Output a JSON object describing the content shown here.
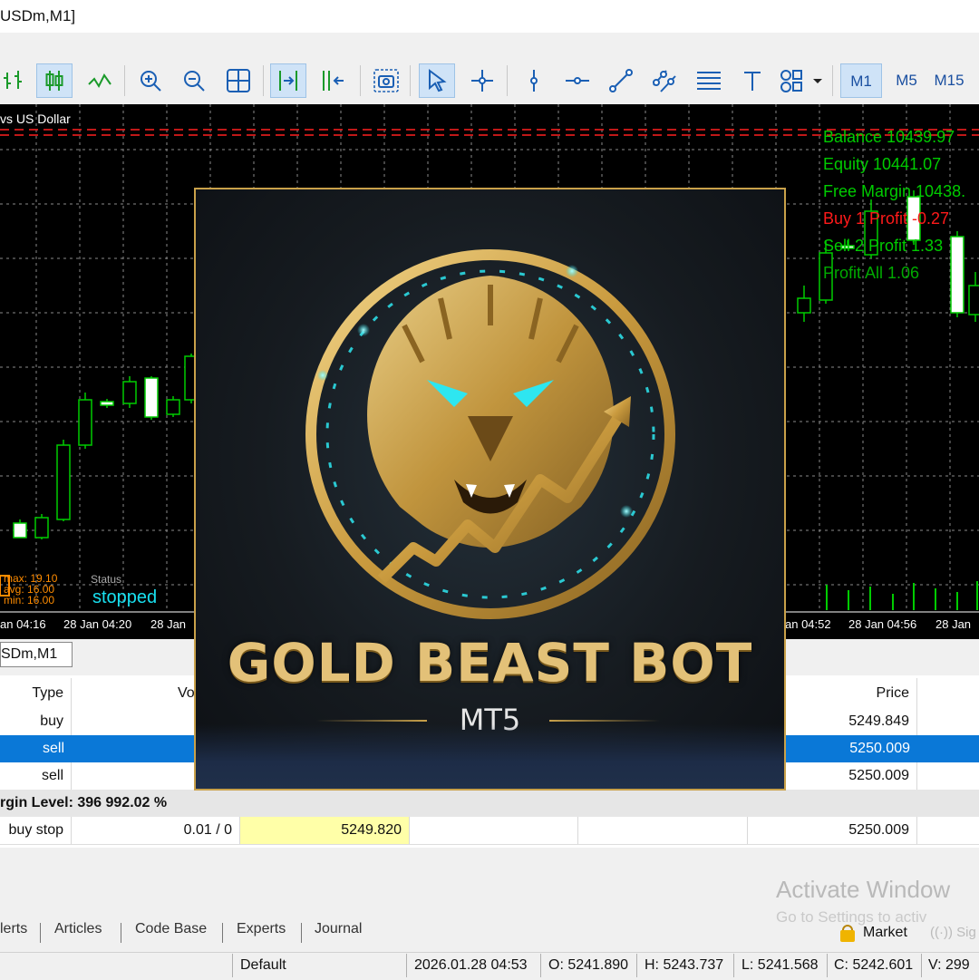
{
  "window": {
    "title": "USDm,M1]"
  },
  "toolbar": {
    "timeframes": [
      "M1",
      "M5",
      "M15"
    ],
    "active_timeframe": "M1"
  },
  "chart": {
    "symbol_label": "vs US Dollar",
    "account": {
      "balance": "Balance 10439.97",
      "equity": "Equity 10441.07",
      "free_margin": "Free Margin 10438.",
      "buy": "Buy 1  Profit -0.27",
      "sell": "Sell 2  Profit 1.33",
      "profit_all": "Profit All 1.06"
    },
    "indicator": {
      "max": "max: 19.10",
      "avg": "avg: 16.00",
      "min": "min: 16.00",
      "status_label": "Status",
      "status_value": "stopped"
    },
    "time_labels": [
      "an 04:16",
      "28 Jan 04:20",
      "28 Jan",
      "an 04:52",
      "28 Jan 04:56",
      "28 Jan"
    ],
    "colors": {
      "bull": "#00cc00",
      "bear": "#ffffff",
      "grid": "#8a8a8a",
      "level": "#ff2020",
      "account_text": "#00cc00",
      "loss_text": "#ff1a1a"
    }
  },
  "chart_tab": "SDm,M1",
  "trade_table": {
    "headers": {
      "type": "Type",
      "volume": "Vo",
      "price": "Price"
    },
    "rows": [
      {
        "type": "buy",
        "price": "5249.849",
        "selected": false
      },
      {
        "type": "sell",
        "price": "5250.009",
        "selected": true
      },
      {
        "type": "sell",
        "price": "5250.009",
        "selected": false
      }
    ],
    "summary": "rgin Level: 396 992.02 %",
    "order": {
      "type": "buy stop",
      "volume": "0.01 / 0",
      "order_price": "5249.820",
      "price": "5250.009"
    }
  },
  "bottom_tabs": [
    "lerts",
    "Articles",
    "Code Base",
    "Experts",
    "Journal"
  ],
  "market": {
    "label": "Market",
    "signals": "Sig"
  },
  "status_bar": {
    "profile": "Default",
    "datetime": "2026.01.28 04:53",
    "open": "O: 5241.890",
    "high": "H: 5243.737",
    "low": "L: 5241.568",
    "close": "C: 5242.601",
    "volume": "V: 299"
  },
  "watermark": {
    "line1": "Activate Window",
    "line2": "Go to Settings to activ"
  },
  "overlay": {
    "title": "GOLD BEAST BOT",
    "subtitle": "MT5",
    "colors": {
      "gold": "#e3c178",
      "glow": "#2ee6f0",
      "bg": "#161b20"
    }
  }
}
